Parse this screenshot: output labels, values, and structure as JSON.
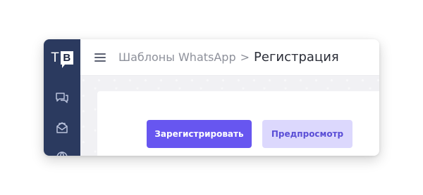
{
  "logo": {
    "t": "T",
    "b": "B"
  },
  "sidebar": {
    "items": [
      {
        "icon": "chat-bubbles-icon"
      },
      {
        "icon": "mail-envelope-icon"
      },
      {
        "icon": "globe-icon"
      }
    ]
  },
  "header": {
    "menu_icon": "hamburger-icon",
    "breadcrumb": {
      "parent": "Шаблоны WhatsApp",
      "separator": ">",
      "current": "Регистрация"
    }
  },
  "actions": {
    "register_label": "Зарегистрировать",
    "preview_label": "Предпросмотр"
  },
  "colors": {
    "sidebar_bg": "#2b3a5f",
    "primary": "#6756f0",
    "secondary_bg": "#dcd8fd",
    "secondary_text": "#5a4ed6"
  }
}
